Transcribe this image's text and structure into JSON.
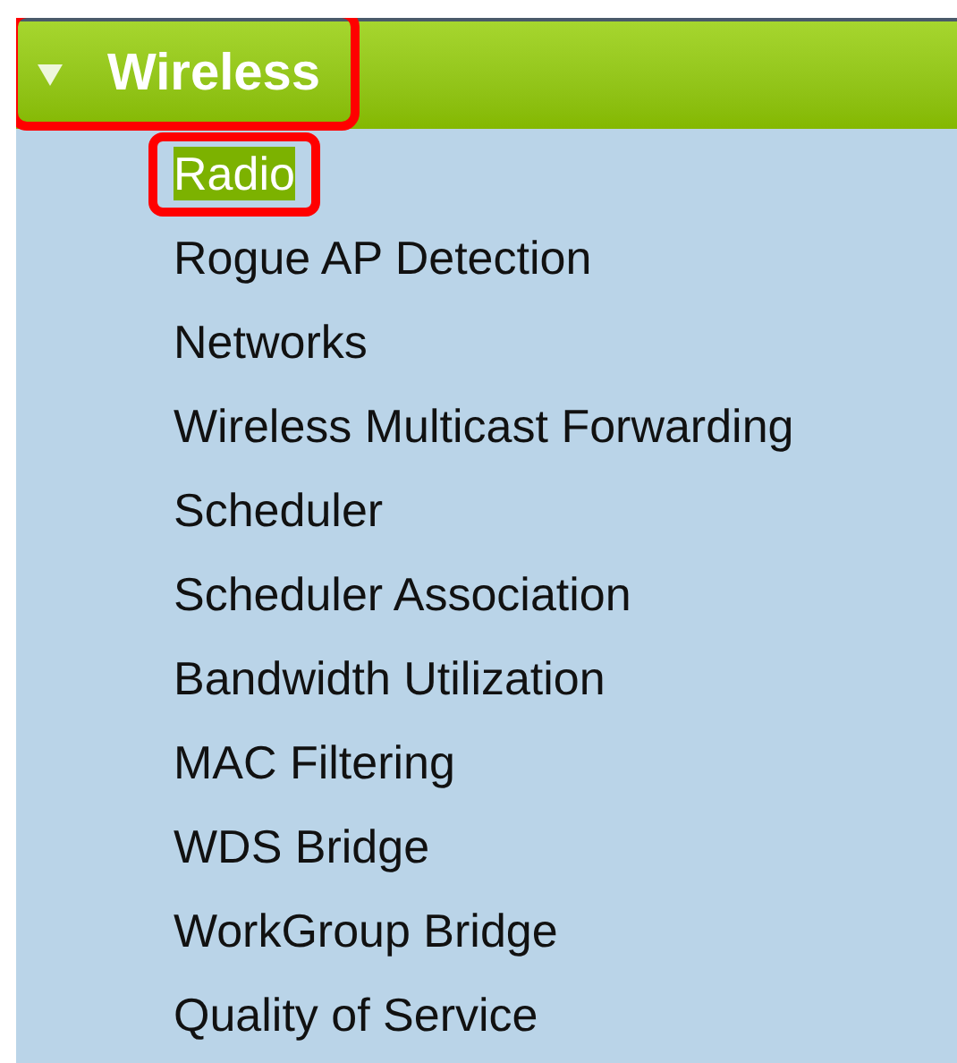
{
  "section": {
    "title": "Wireless",
    "expanded": true,
    "highlighted": true
  },
  "items": [
    {
      "label": "Radio",
      "selected": true,
      "highlighted": true
    },
    {
      "label": "Rogue AP Detection",
      "selected": false,
      "highlighted": false
    },
    {
      "label": "Networks",
      "selected": false,
      "highlighted": false
    },
    {
      "label": "Wireless Multicast Forwarding",
      "selected": false,
      "highlighted": false
    },
    {
      "label": "Scheduler",
      "selected": false,
      "highlighted": false
    },
    {
      "label": "Scheduler Association",
      "selected": false,
      "highlighted": false
    },
    {
      "label": "Bandwidth Utilization",
      "selected": false,
      "highlighted": false
    },
    {
      "label": "MAC Filtering",
      "selected": false,
      "highlighted": false
    },
    {
      "label": "WDS Bridge",
      "selected": false,
      "highlighted": false
    },
    {
      "label": "WorkGroup Bridge",
      "selected": false,
      "highlighted": false
    },
    {
      "label": "Quality of Service",
      "selected": false,
      "highlighted": false
    }
  ]
}
